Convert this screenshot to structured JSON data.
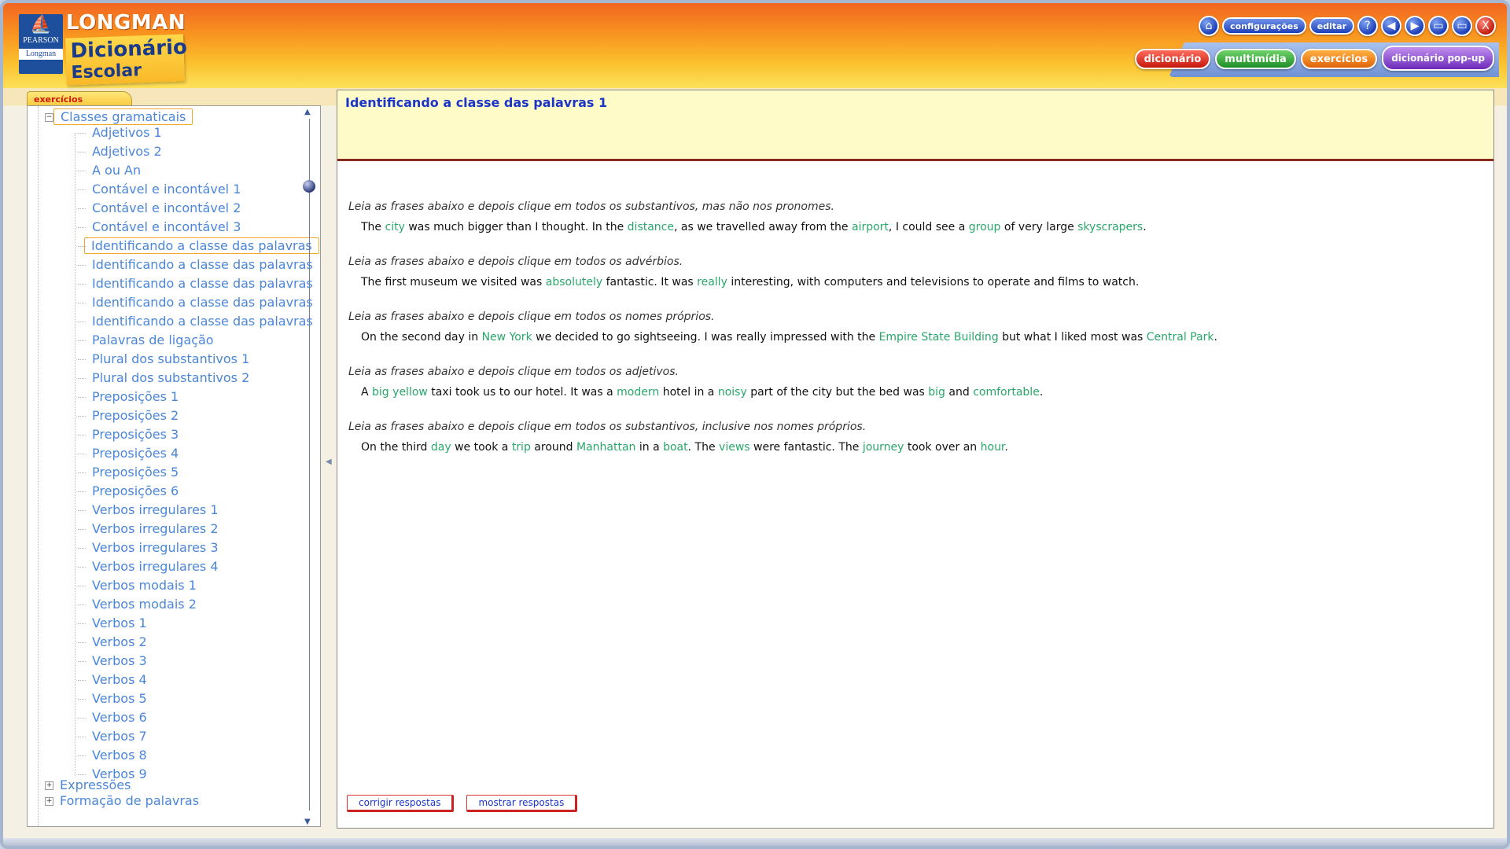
{
  "header": {
    "publisher_line1": "PEARSON",
    "publisher_line2": "Longman",
    "brand": "LONGMAN",
    "brand_title_1": "Dicionário",
    "brand_title_2": "Escolar",
    "controls": {
      "home_icon": "home-icon",
      "settings_label": "configurações",
      "edit_label": "editar",
      "help_glyph": "?",
      "back_glyph": "◀",
      "forward_glyph": "▶",
      "restore_glyph": "▭",
      "maximize_glyph": "▭",
      "close_glyph": "X"
    },
    "section_tabs": {
      "dictionary": "dicionário",
      "multimedia": "multimídia",
      "exercises": "exercícios",
      "popup": "dicionário pop-up"
    }
  },
  "sidebar": {
    "tab_label": "exercícios",
    "tree": {
      "group_label": "Classes gramaticais",
      "toggle_open": "−",
      "toggle_closed": "+",
      "items": [
        "Adjetivos 1",
        "Adjetivos 2",
        "A ou An",
        "Contável e incontável 1",
        "Contável e incontável 2",
        "Contável e incontável 3",
        "Identificando a classe das palavras",
        "Identificando a classe das palavras",
        "Identificando a classe das palavras",
        "Identificando a classe das palavras",
        "Identificando a classe das palavras",
        "Palavras de ligação",
        "Plural dos substantivos 1",
        "Plural dos substantivos 2",
        "Preposições 1",
        "Preposições 2",
        "Preposições 3",
        "Preposições 4",
        "Preposições 5",
        "Preposições 6",
        "Verbos irregulares 1",
        "Verbos irregulares 2",
        "Verbos irregulares 3",
        "Verbos irregulares 4",
        "Verbos modais 1",
        "Verbos modais 2",
        "Verbos 1",
        "Verbos 2",
        "Verbos 3",
        "Verbos 4",
        "Verbos 5",
        "Verbos 6",
        "Verbos 7",
        "Verbos 8",
        "Verbos 9"
      ],
      "current_index": 6,
      "collapsed_groups": [
        "Expressões",
        "Formação de palavras"
      ]
    }
  },
  "main": {
    "title": "Identificando a classe das palavras 1",
    "exercises": [
      {
        "instruction": "Leia as frases abaixo e depois clique em todos os substantivos, mas não nos pronomes.",
        "tokens": [
          {
            "t": "The "
          },
          {
            "t": "city",
            "w": true
          },
          {
            "t": " was much bigger than I thought. In the "
          },
          {
            "t": "distance",
            "w": true
          },
          {
            "t": ", as we travelled away from the "
          },
          {
            "t": "airport",
            "w": true
          },
          {
            "t": ", I could see a "
          },
          {
            "t": "group",
            "w": true
          },
          {
            "t": " of very large "
          },
          {
            "t": "skyscrapers",
            "w": true
          },
          {
            "t": "."
          }
        ]
      },
      {
        "instruction": "Leia as frases abaixo e depois clique em todos os advérbios.",
        "tokens": [
          {
            "t": "The first museum we visited was "
          },
          {
            "t": "absolutely",
            "w": true
          },
          {
            "t": " fantastic. It was "
          },
          {
            "t": "really",
            "w": true
          },
          {
            "t": " interesting, with computers and televisions to operate and films to watch."
          }
        ]
      },
      {
        "instruction": "Leia as frases abaixo e depois clique em todos os nomes próprios.",
        "tokens": [
          {
            "t": "On the second day in "
          },
          {
            "t": "New York",
            "w": true
          },
          {
            "t": " we decided to go sightseeing. I was really impressed with the "
          },
          {
            "t": "Empire State Building",
            "w": true
          },
          {
            "t": " but what I liked most was "
          },
          {
            "t": "Central Park",
            "w": true
          },
          {
            "t": "."
          }
        ]
      },
      {
        "instruction": "Leia as frases abaixo e depois clique em todos os adjetivos.",
        "tokens": [
          {
            "t": "A "
          },
          {
            "t": "big",
            "w": true
          },
          {
            "t": " "
          },
          {
            "t": "yellow",
            "w": true
          },
          {
            "t": " taxi took us to our hotel. It was a "
          },
          {
            "t": "modern",
            "w": true
          },
          {
            "t": " hotel in a "
          },
          {
            "t": "noisy",
            "w": true
          },
          {
            "t": " part of the city but the bed was "
          },
          {
            "t": "big",
            "w": true
          },
          {
            "t": " and "
          },
          {
            "t": "comfortable",
            "w": true
          },
          {
            "t": "."
          }
        ]
      },
      {
        "instruction": "Leia as frases abaixo e depois clique em todos os substantivos, inclusive nos nomes próprios.",
        "tokens": [
          {
            "t": "On the third "
          },
          {
            "t": "day",
            "w": true
          },
          {
            "t": " we took a "
          },
          {
            "t": "trip",
            "w": true
          },
          {
            "t": " around "
          },
          {
            "t": "Manhattan",
            "w": true
          },
          {
            "t": " in a "
          },
          {
            "t": "boat",
            "w": true
          },
          {
            "t": ". The "
          },
          {
            "t": "views",
            "w": true
          },
          {
            "t": " were fantastic. The "
          },
          {
            "t": "journey",
            "w": true
          },
          {
            "t": " took over an "
          },
          {
            "t": "hour",
            "w": true
          },
          {
            "t": "."
          }
        ]
      }
    ],
    "check_label": "corrigir respostas",
    "show_label": "mostrar respostas"
  },
  "colors": {
    "clickable_word": "#2aa66b",
    "tree_text": "#4b86d8",
    "title": "#1a35c8"
  }
}
